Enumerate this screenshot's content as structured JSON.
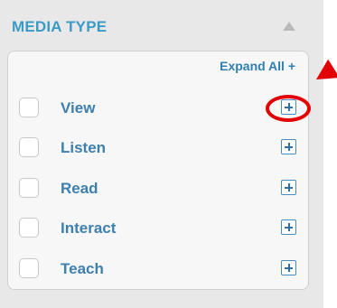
{
  "header": {
    "title": "MEDIA TYPE"
  },
  "filter": {
    "expand_all_label": "Expand All +",
    "items": [
      {
        "label": "View",
        "checked": false
      },
      {
        "label": "Listen",
        "checked": false
      },
      {
        "label": "Read",
        "checked": false
      },
      {
        "label": "Interact",
        "checked": false
      },
      {
        "label": "Teach",
        "checked": false
      }
    ]
  },
  "colors": {
    "title": "#3a9bc7",
    "label": "#3d7fad",
    "highlight": "#e30000",
    "panel_bg": "#e8e8e8"
  }
}
